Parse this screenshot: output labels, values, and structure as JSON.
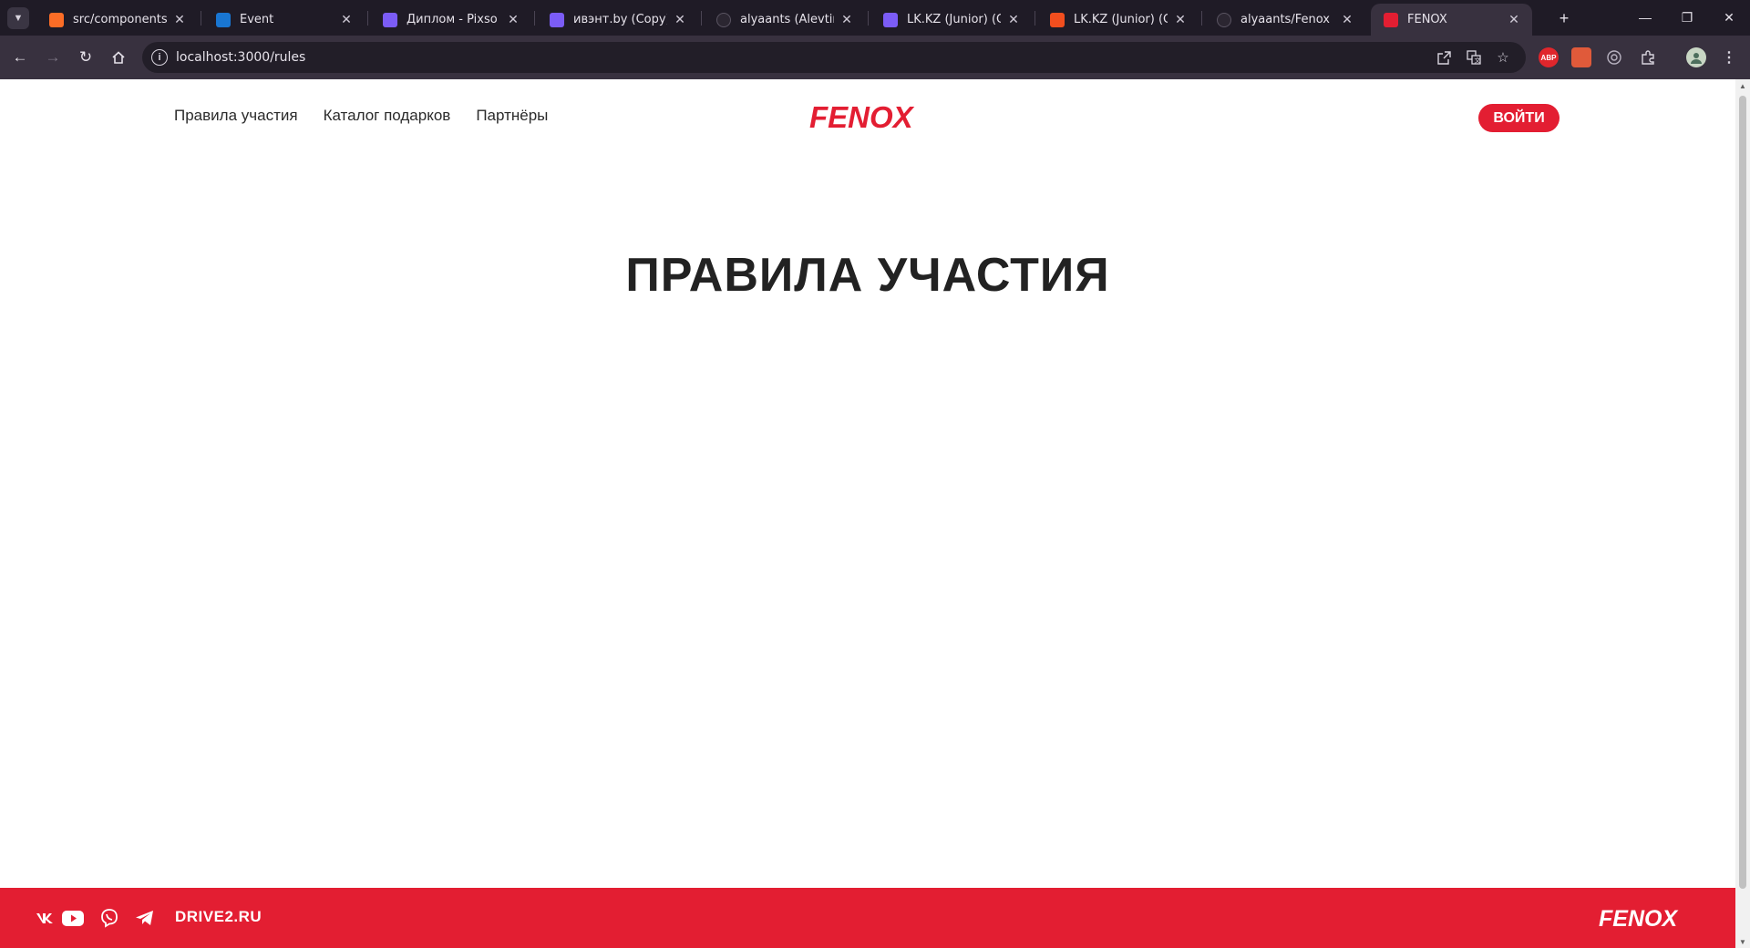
{
  "browser": {
    "tabs": [
      {
        "title": "src/components/Stick",
        "icon": "gitlab-icon",
        "color": "#fc6d26"
      },
      {
        "title": "Event",
        "icon": "event-icon",
        "color": "#1976d2"
      },
      {
        "title": "Диплом - Pixso",
        "icon": "pixso-icon",
        "color": "#7b5cf6"
      },
      {
        "title": "ивэнт.by (Copy) - Pixso",
        "icon": "pixso-icon",
        "color": "#7b5cf6"
      },
      {
        "title": "alyaants (Alevtina Antonova)",
        "icon": "github-icon",
        "color": "#2b2631"
      },
      {
        "title": "LK.KZ (Junior) (Copy)",
        "icon": "pixso-icon",
        "color": "#7b5cf6"
      },
      {
        "title": "LK.KZ (Junior) (Copy)",
        "icon": "figma-icon",
        "color": "#f24e1e"
      },
      {
        "title": "alyaants/Fenox",
        "icon": "github-icon",
        "color": "#2b2631"
      },
      {
        "title": "FENOX",
        "icon": "fenox-icon",
        "color": "#e31e32",
        "active": true
      }
    ],
    "url": "localhost:3000/rules",
    "extensions": [
      {
        "name": "adblock-icon",
        "label": "ABP",
        "color": "#e0262c"
      },
      {
        "name": "screenshot-extension-icon",
        "label": "",
        "color": "#e05a3a"
      },
      {
        "name": "target-extension-icon",
        "label": "",
        "color": "#8a8492"
      }
    ]
  },
  "site": {
    "nav": {
      "rules": "Правила участия",
      "catalog": "Каталог подарков",
      "partners": "Партнёры"
    },
    "logo": "FENOX",
    "login_label": "ВОЙТИ",
    "page_title": "ПРАВИЛА УЧАСТИЯ",
    "brand_color": "#e31e32",
    "footer": {
      "social": [
        "vk-icon",
        "youtube-icon",
        "viber-icon",
        "telegram-icon"
      ],
      "drive_label": "DRIVE2.RU",
      "logo": "FENOX"
    }
  }
}
